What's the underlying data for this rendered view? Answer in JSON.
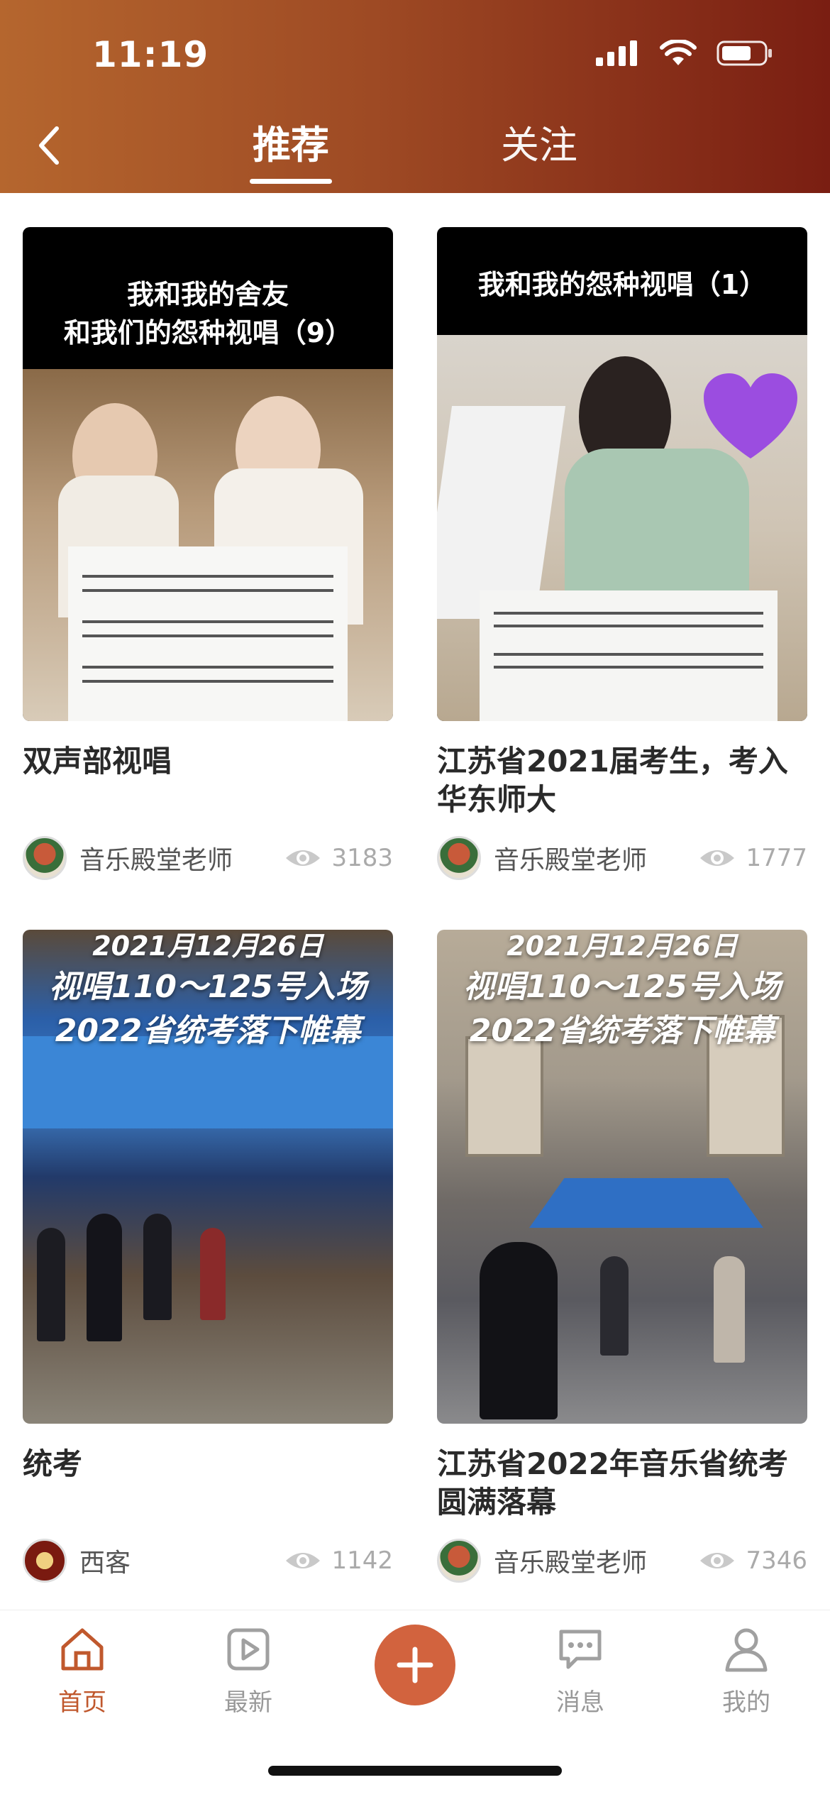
{
  "status_bar": {
    "time": "11:19"
  },
  "header": {
    "tabs": [
      {
        "label": "推荐",
        "active": true
      },
      {
        "label": "关注",
        "active": false
      }
    ]
  },
  "cards": [
    {
      "title": "双声部视唱",
      "thumb_caption": [
        "我和我的舍友",
        "和我们的怨种视唱（9）"
      ],
      "author": "音乐殿堂老师",
      "views": "3183"
    },
    {
      "title": "江苏省2021届考生，考入华东师大",
      "thumb_caption": [
        "我和我的怨种视唱（1）"
      ],
      "author": "音乐殿堂老师",
      "views": "1777"
    },
    {
      "title": "统考",
      "thumb_caption": [
        "2021月12月26日",
        "视唱110～125号入场",
        "2022省统考落下帷幕"
      ],
      "author": "西客",
      "views": "1142"
    },
    {
      "title": "江苏省2022年音乐省统考圆满落幕",
      "thumb_caption": [
        "2021月12月26日",
        "视唱110～125号入场",
        "2022省统考落下帷幕"
      ],
      "author": "音乐殿堂老师",
      "views": "7346"
    }
  ],
  "bottom_nav": {
    "items": [
      {
        "label": "首页",
        "icon": "home-icon",
        "active": true
      },
      {
        "label": "最新",
        "icon": "play-icon",
        "active": false
      },
      {
        "label": "消息",
        "icon": "message-icon",
        "active": false
      },
      {
        "label": "我的",
        "icon": "profile-icon",
        "active": false
      }
    ]
  },
  "colors": {
    "header_gradient_start": "#b5662e",
    "header_gradient_end": "#7a1e12",
    "accent": "#d2633e",
    "active_nav": "#c0582d"
  }
}
